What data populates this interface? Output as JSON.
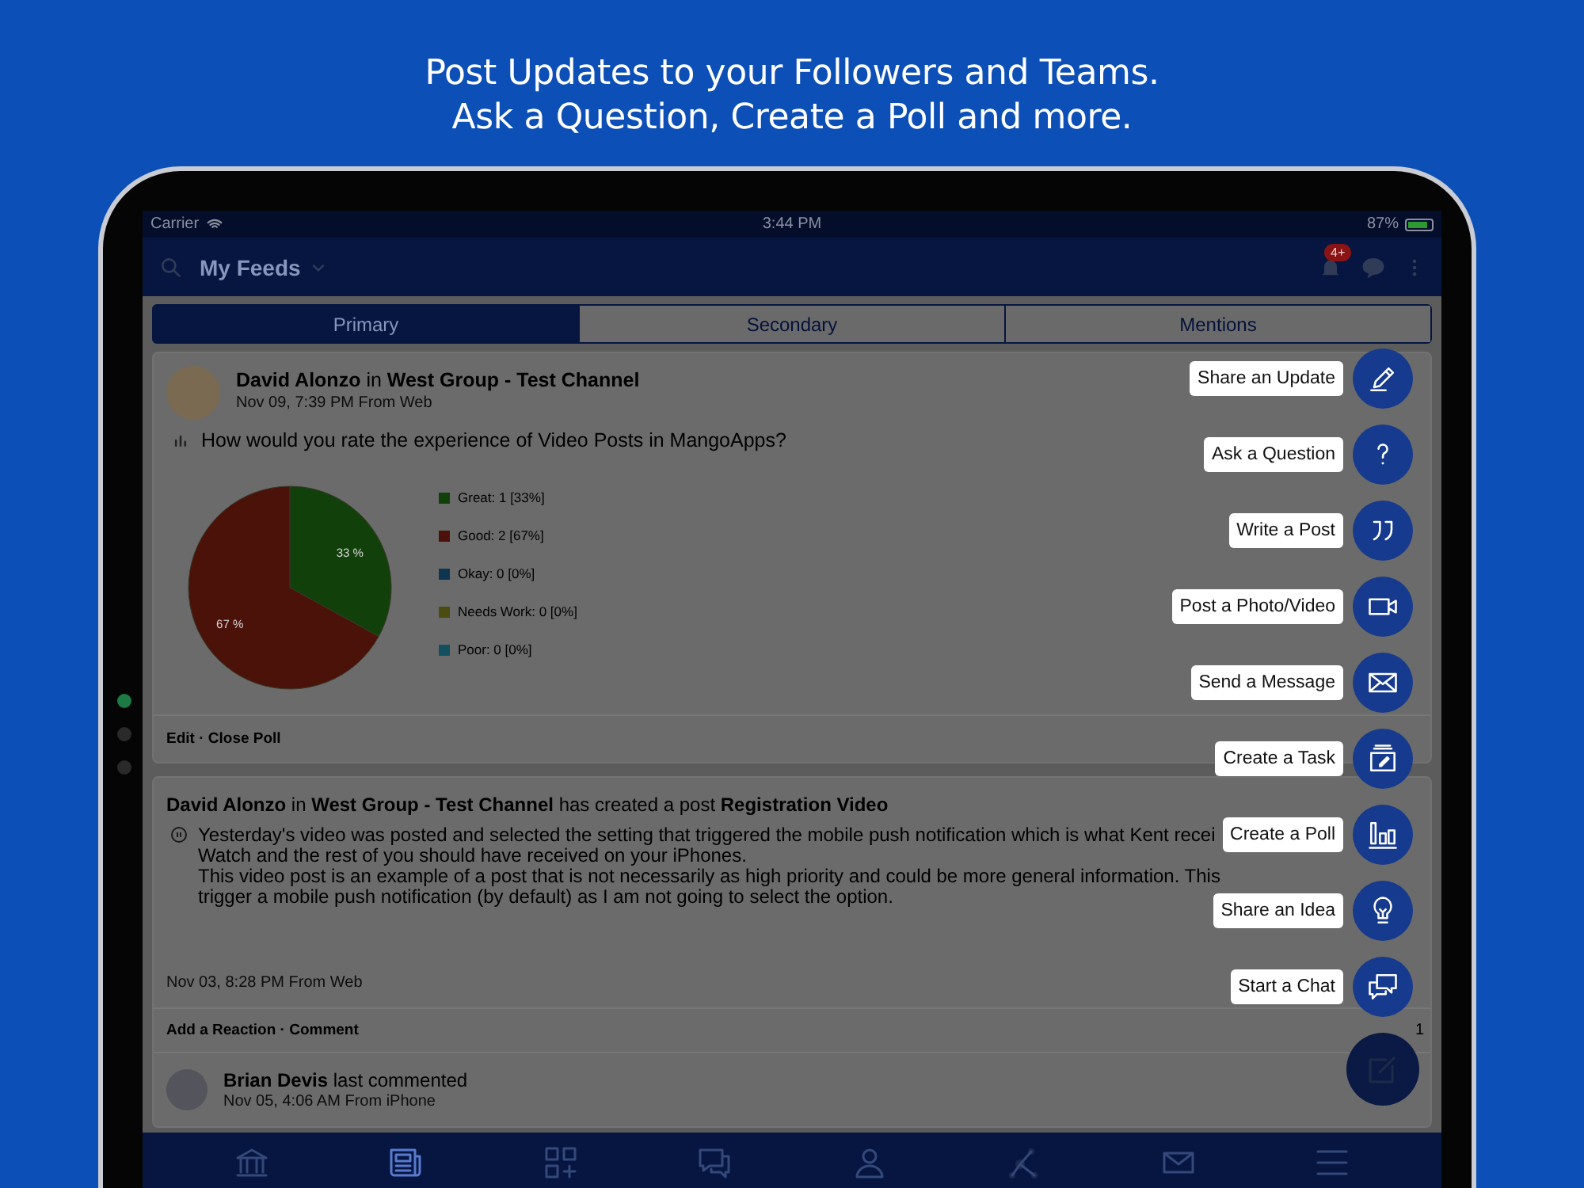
{
  "headline": [
    "Post Updates to your Followers and Teams.",
    "Ask a Question, Create a Poll and more."
  ],
  "status_bar": {
    "carrier": "Carrier",
    "time": "3:44 PM",
    "battery": "87%"
  },
  "nav_bar": {
    "title": "My Feeds",
    "notification_badge": "4+"
  },
  "tabs": [
    {
      "label": "Primary",
      "selected": true
    },
    {
      "label": "Secondary",
      "selected": false
    },
    {
      "label": "Mentions",
      "selected": false
    }
  ],
  "posts": [
    {
      "kind": "poll",
      "author": "David Alonzo",
      "connector": "in",
      "channel": "West Group - Test Channel",
      "meta": "Nov 09, 7:39 PM From Web",
      "question": "How would you rate the experience of Video Posts in MangoApps?",
      "chart_data": {
        "type": "pie",
        "categories": [
          "Great: 1 [33%]",
          "Good: 2 [67%]",
          "Okay: 0 [0%]",
          "Needs Work: 0 [0%]",
          "Poor: 0 [0%]"
        ],
        "values": [
          33,
          67,
          0,
          0,
          0
        ],
        "value_labels": [
          "33 %",
          "67 %",
          null,
          null,
          null
        ],
        "colors": [
          "#12400a",
          "#4a1208",
          "#0e3650",
          "#4a4c10",
          "#125060"
        ],
        "legend": "right"
      },
      "actions": "Edit · Close Poll"
    },
    {
      "kind": "video",
      "author": "David Alonzo",
      "connector": "in",
      "channel": "West Group - Test Channel",
      "activity": "has created a post",
      "title": "Registration Video",
      "body": [
        "Yesterday's video was posted and selected the setting that triggered the mobile push notification which is what Kent recei",
        "Watch and the rest of you should have received on your iPhones.",
        "This video post is an example of a post that is not necessarily as high priority and could be more general information. This",
        "trigger a mobile push notification (by default) as I am not going to select the option."
      ],
      "meta": "Nov 03, 8:28 PM From Web",
      "actions": "Add a Reaction · Comment",
      "reaction_count": "1",
      "commenter": "Brian Devis",
      "comment_note": "last commented",
      "comment_meta": "Nov 05, 4:06 AM From iPhone"
    }
  ],
  "bottom_tabs": [
    {
      "kind": "bank",
      "selected": false
    },
    {
      "kind": "news",
      "selected": true
    },
    {
      "kind": "apps",
      "selected": false
    },
    {
      "kind": "chat",
      "selected": false
    },
    {
      "kind": "person",
      "selected": false
    },
    {
      "kind": "network",
      "selected": false
    },
    {
      "kind": "mail",
      "selected": false
    },
    {
      "kind": "menu",
      "selected": false
    }
  ],
  "fab_menu": [
    {
      "kind": "update",
      "label": "Share an Update"
    },
    {
      "kind": "question",
      "label": "Ask a Question"
    },
    {
      "kind": "post",
      "label": "Write a Post"
    },
    {
      "kind": "media",
      "label": "Post a Photo/Video"
    },
    {
      "kind": "message",
      "label": "Send a Message"
    },
    {
      "kind": "task",
      "label": "Create a Task"
    },
    {
      "kind": "poll",
      "label": "Create a Poll"
    },
    {
      "kind": "idea",
      "label": "Share an Idea"
    },
    {
      "kind": "chat",
      "label": "Start a Chat"
    }
  ]
}
